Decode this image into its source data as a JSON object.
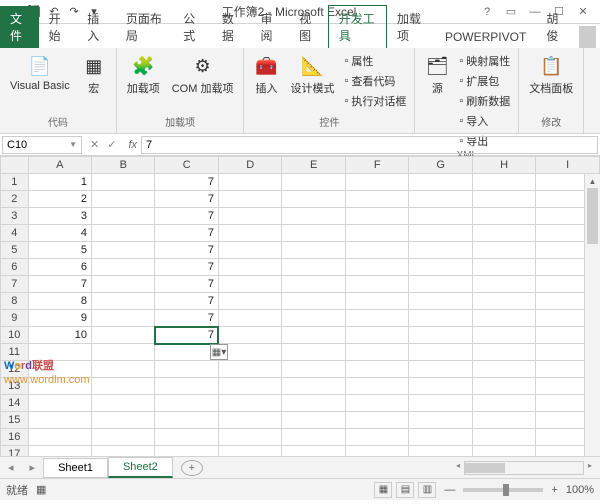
{
  "title": "工作簿2 - Microsoft Excel",
  "tabs": {
    "file": "文件",
    "items": [
      "开始",
      "插入",
      "页面布局",
      "公式",
      "数据",
      "审阅",
      "视图",
      "开发工具",
      "加载项",
      "POWERPIVOT",
      "胡俊"
    ],
    "active": "开发工具"
  },
  "ribbon": {
    "groups": [
      {
        "label": "代码",
        "big": [
          {
            "icon": "📄",
            "label": "Visual Basic"
          },
          {
            "icon": "▦",
            "label": "宏"
          }
        ]
      },
      {
        "label": "加载项",
        "big": [
          {
            "icon": "🧩",
            "label": "加载项"
          },
          {
            "icon": "⚙",
            "label": "COM 加载项"
          }
        ]
      },
      {
        "label": "控件",
        "big": [
          {
            "icon": "🧰",
            "label": "插入"
          },
          {
            "icon": "📐",
            "label": "设计模式"
          }
        ],
        "small": [
          "属性",
          "查看代码",
          "执行对话框"
        ]
      },
      {
        "label": "XML",
        "big": [
          {
            "icon": "🗂",
            "label": "源"
          }
        ],
        "small": [
          "映射属性",
          "扩展包",
          "刷新数据",
          "导入",
          "导出"
        ]
      },
      {
        "label": "修改",
        "big": [
          {
            "icon": "📋",
            "label": "文档面板"
          }
        ]
      }
    ]
  },
  "namebox": "C10",
  "formula": "7",
  "columns": [
    "A",
    "B",
    "C",
    "D",
    "E",
    "F",
    "G",
    "H",
    "I"
  ],
  "rows": [
    1,
    2,
    3,
    4,
    5,
    6,
    7,
    8,
    9,
    10,
    11,
    12,
    13,
    14,
    15,
    16,
    17
  ],
  "cells": {
    "A": [
      1,
      2,
      3,
      4,
      5,
      6,
      7,
      8,
      9,
      10
    ],
    "C": [
      7,
      7,
      7,
      7,
      7,
      7,
      7,
      7,
      7,
      7
    ]
  },
  "active_cell": {
    "row": 10,
    "col": "C"
  },
  "watermark": {
    "text": "Word联盟",
    "url": "www.wordlm.com"
  },
  "sheets": [
    "Sheet1",
    "Sheet2"
  ],
  "active_sheet": "Sheet2",
  "status": "就绪",
  "zoom": "100%"
}
